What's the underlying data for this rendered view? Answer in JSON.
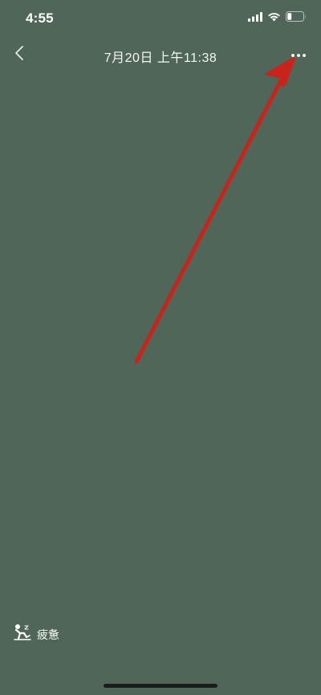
{
  "status_bar": {
    "time": "4:55",
    "icons": [
      "signal-icon",
      "wifi-icon",
      "battery-icon"
    ]
  },
  "nav": {
    "back_icon": "chevron-left-icon",
    "title": "7月20日 上午11:38",
    "more_icon": "ellipsis-icon"
  },
  "annotation": {
    "arrow_color": "#c8241c",
    "arrow_icon": "red-arrow-annotation"
  },
  "mood": {
    "icon": "tired-person-icon",
    "label": "疲惫"
  },
  "colors": {
    "background": "#4f6659",
    "text": "#ffffff"
  }
}
